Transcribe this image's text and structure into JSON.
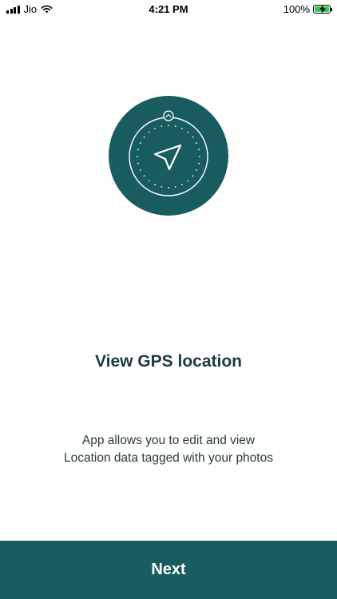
{
  "status_bar": {
    "carrier": "Jio",
    "time": "4:21 PM",
    "battery_percent": "100%",
    "battery_level": 1.0,
    "icons": [
      "signal-icon",
      "wifi-icon",
      "battery-icon",
      "charging-bolt-icon"
    ]
  },
  "onboarding": {
    "illustration_icon": "gps-compass-icon",
    "accent_color": "#185c5f",
    "title": "View GPS location",
    "description_lines": [
      "App allows you to edit and view",
      "Location data tagged with your photos"
    ]
  },
  "footer": {
    "next_label": "Next",
    "button_color": "#185c5f"
  }
}
